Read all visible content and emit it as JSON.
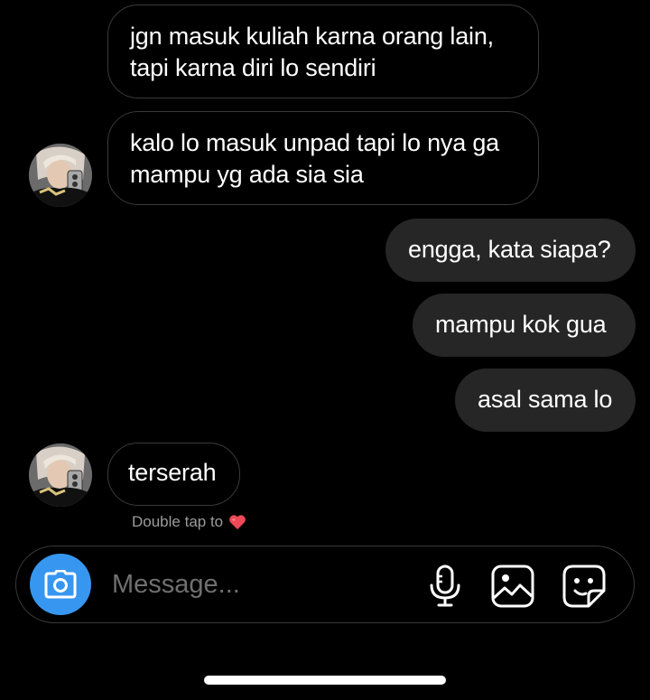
{
  "messages": [
    {
      "side": "received",
      "text_line1": "jgn masuk kuliah karna orang lain,",
      "text_line2": "tapi karna diri lo sendiri"
    },
    {
      "side": "received",
      "text_line1": "kalo lo masuk unpad tapi lo nya ga",
      "text_line2": "mampu yg ada sia sia"
    },
    {
      "side": "sent",
      "text": "engga, kata siapa?"
    },
    {
      "side": "sent",
      "text": "mampu kok gua"
    },
    {
      "side": "sent",
      "text": "asal sama lo"
    },
    {
      "side": "received",
      "text": "terserah"
    }
  ],
  "double_tap": {
    "text": "Double tap to",
    "reaction_icon": "heart-emoji"
  },
  "composer": {
    "placeholder": "Message...",
    "camera_icon": "camera-icon",
    "mic_icon": "microphone-icon",
    "gallery_icon": "gallery-icon",
    "sticker_icon": "sticker-icon"
  },
  "colors": {
    "background": "#000000",
    "sent_bubble": "#262626",
    "received_border": "#3a3a3c",
    "accent": "#3797f0",
    "heart": "#ed4956"
  }
}
